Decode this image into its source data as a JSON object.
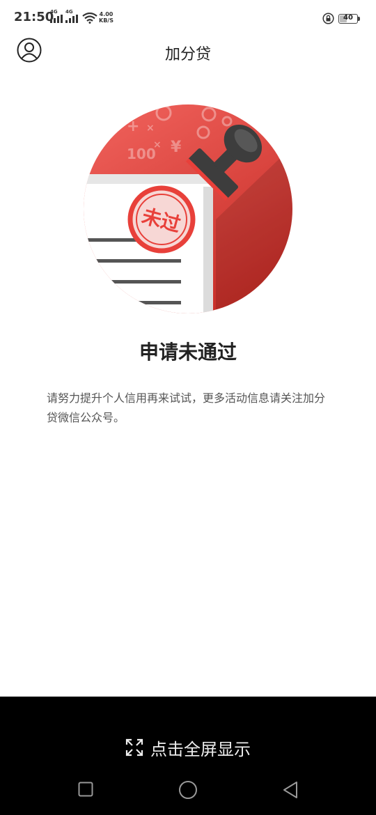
{
  "status_bar": {
    "time": "21:50",
    "signal1_label": "4G",
    "signal2_label": "4G",
    "speed_value": "4.00",
    "speed_unit": "KB/S",
    "battery": "40"
  },
  "header": {
    "title": "加分贷"
  },
  "illustration": {
    "stamp_text": "未过",
    "currency_symbol": "¥",
    "number_text": "100"
  },
  "result": {
    "title": "申请未通过",
    "description": "请努力提升个人信用再来试试，更多活动信息请关注加分贷微信公众号。"
  },
  "bottom": {
    "fullscreen_label": "点击全屏显示"
  },
  "colors": {
    "accent_red": "#e8403a",
    "circle_top": "#f2645e",
    "stamp_dark": "#3d3d3d"
  }
}
